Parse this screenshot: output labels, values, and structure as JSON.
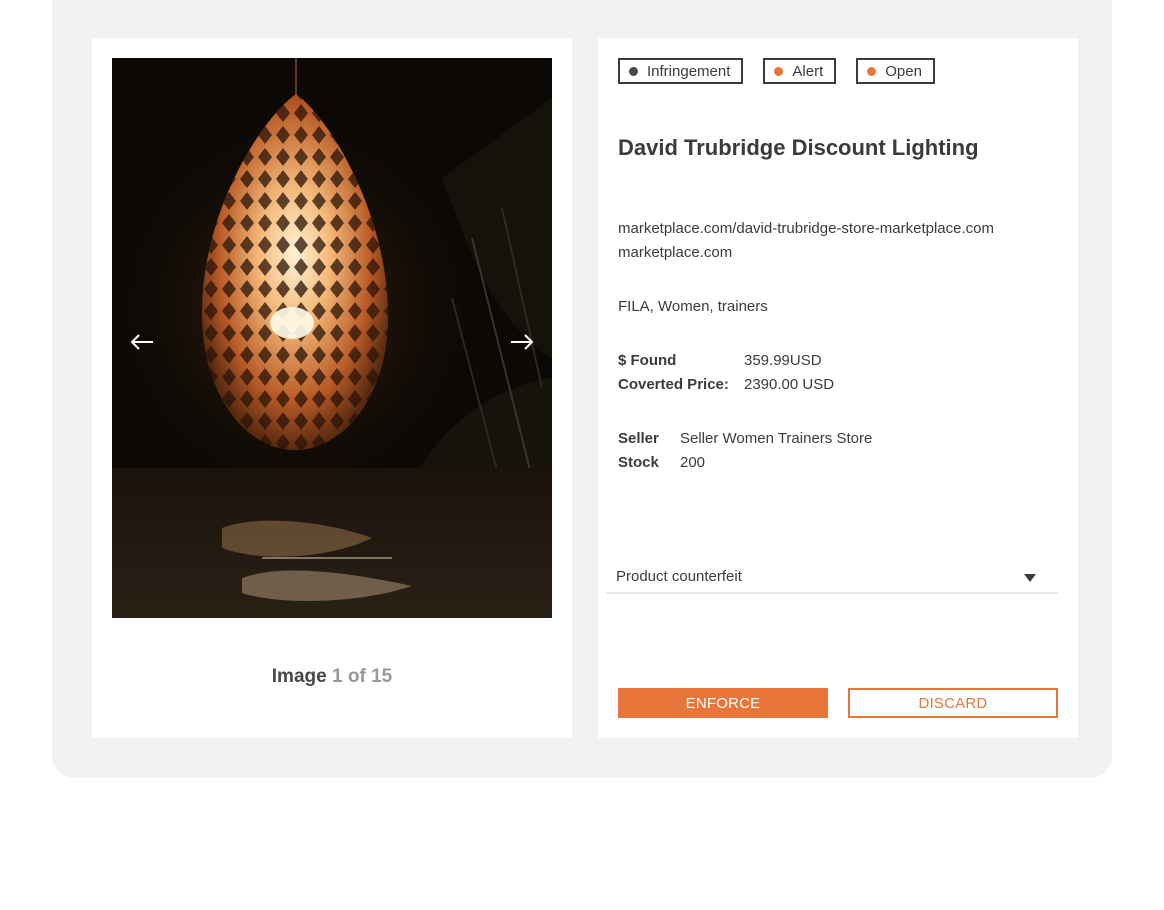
{
  "viewer": {
    "image_label": "Image",
    "current": "1",
    "of_label": "of",
    "total": "15",
    "prev_icon": "arrow-left-icon",
    "next_icon": "arrow-right-icon"
  },
  "tags": [
    {
      "label": "Infringement",
      "dot_color": "#4a4644"
    },
    {
      "label": "Alert",
      "dot_color": "#e8763a"
    },
    {
      "label": "Open",
      "dot_color": "#e8763a"
    }
  ],
  "listing": {
    "title": "David Trubridge Discount Lighting",
    "url": "marketplace.com/david-trubridge-store-marketplace.com",
    "domain": "marketplace.com",
    "keywords": "FILA, Women, trainers",
    "found_label": "$ Found",
    "found_value": "359.99USD",
    "converted_label": "Coverted Price:",
    "converted_value": "2390.00 USD",
    "seller_label": "Seller",
    "seller_value": "Seller Women Trainers Store",
    "stock_label": "Stock",
    "stock_value": "200"
  },
  "reason_select": {
    "selected": "Product counterfeit"
  },
  "actions": {
    "enforce_label": "ENFORCE",
    "discard_label": "DISCARD"
  },
  "colors": {
    "accent": "#e8763a",
    "text": "#3d3a38",
    "frame": "#f1f2f3"
  }
}
